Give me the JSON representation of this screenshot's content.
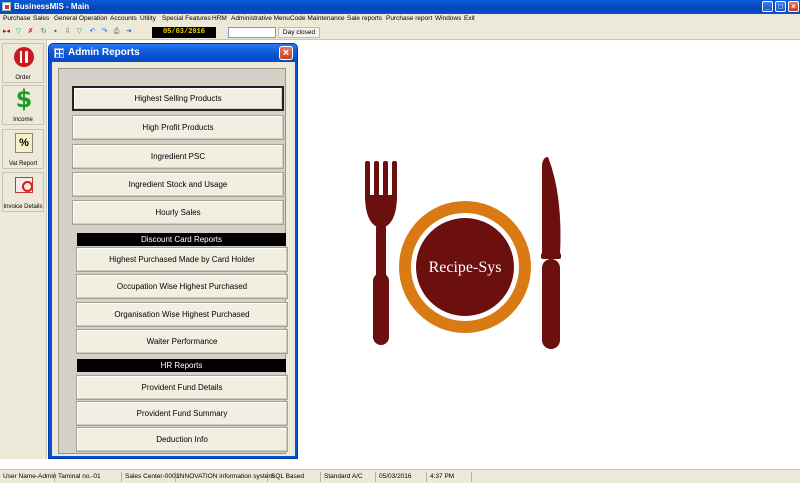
{
  "window": {
    "title": "BusinessMIS - Main",
    "controls": [
      "_",
      "□",
      "×"
    ]
  },
  "menu": [
    "Purchase",
    "Sales",
    "General Operation",
    "Accounts",
    "Utility",
    "Special Features",
    "HRM",
    "Administrative Menu",
    "Code Maintenance",
    "Sale reports",
    "Purchase report",
    "Windows",
    "Exit"
  ],
  "toolbar": {
    "date": "05/03/2016",
    "day_closed_label": "Day closed",
    "icons": [
      "record-nav-icon",
      "filter-icon",
      "clear-filter-icon",
      "refresh-icon",
      "save-icon",
      "export-icon",
      "filter-2-icon",
      "undo-icon",
      "redo-icon",
      "print-icon",
      "exit-icon"
    ]
  },
  "sidebar": {
    "items": [
      {
        "label": "Order",
        "icon": "fork-knife-icon"
      },
      {
        "label": "Income",
        "icon": "dollar-icon"
      },
      {
        "label": "Vat Report",
        "icon": "percent-icon"
      },
      {
        "label": "Invoice Details",
        "icon": "invoice-search-icon"
      }
    ]
  },
  "dialog": {
    "title": "Admin Reports",
    "close": "×",
    "buttons_top": [
      "Highest Selling Products",
      "High Profit Products",
      "Ingredient PSC",
      "Ingredient Stock and Usage",
      "Hourly Sales"
    ],
    "discount_header": "Discount Card Reports",
    "buttons_discount": [
      "Highest Purchased Made by Card Holder",
      "Occupation Wise Highest Purchased",
      "Organisation Wise Highest Purchased",
      "Waiter Performance"
    ],
    "hr_header": "HR Reports",
    "buttons_hr": [
      "Provident Fund Details",
      "Provident Fund Summary",
      "Deduction Info"
    ]
  },
  "logo": {
    "text": "Recipe-Sys",
    "colors": {
      "dark": "#6b0f0f",
      "ring": "#d97a14"
    }
  },
  "status": [
    "User Name-Admin",
    "Taminal no.-01",
    "Sales Center-0001",
    "INNOVATION information system",
    "SQL Based",
    "Standard A/C",
    "05/03/2016",
    "4:37 PM"
  ]
}
